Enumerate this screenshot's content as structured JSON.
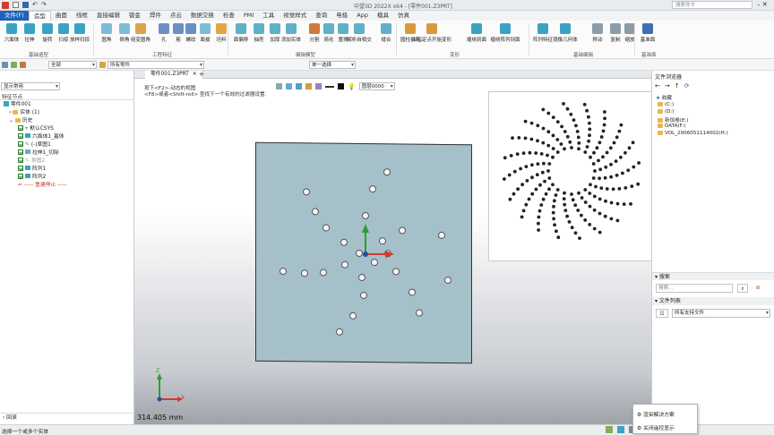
{
  "app": {
    "title": "中望3D 2022X x64 - [零件001.Z3PRT]",
    "search_placeholder": "搜索命令"
  },
  "menu": {
    "items": [
      "文件(F)",
      "造型",
      "曲面",
      "线框",
      "直接编辑",
      "钣金",
      "焊件",
      "点云",
      "数据交换",
      "检查",
      "PMI",
      "工具",
      "视觉样式",
      "查询",
      "电极",
      "App",
      "模具",
      "仿真"
    ],
    "active_index": 1
  },
  "ribbon": {
    "buttons": [
      "六面体",
      "拉伸",
      "旋转",
      "扫掠",
      "放样扫掠",
      "圆角",
      "倒角",
      "组变圆角",
      "孔",
      "筋",
      "螺纹",
      "面拔",
      "坯料",
      "面偏移",
      "抽壳",
      "加厚",
      "添加实体",
      "分割",
      "简化",
      "置换",
      "解析自相交",
      "缝合",
      "圆柱折弯",
      "由指定点开始变形",
      "缠绕到面",
      "缠绕阵列到面",
      "阵列特征",
      "镜像几何体",
      "移动",
      "复制",
      "缩放",
      "基准面"
    ],
    "groups": [
      "基础造型",
      "工程特征",
      "编辑模型",
      "变形",
      "基础编辑",
      "基准面"
    ]
  },
  "toolbar2": {
    "filter_all": "全部",
    "filter_parts": "所有零件",
    "select_mode": "单一选择",
    "layer": "图层0000"
  },
  "left_panel": {
    "display_combo": "显示常用",
    "tree_header": "特征节点",
    "tree": [
      "零件001",
      "实体 (1)",
      "历史",
      "默认CSYS",
      "六面体1_基体",
      "(-)草图1",
      "拉伸1_切除",
      "草图2",
      "阵列1",
      "阵列2",
      "----- 重建停止 -----"
    ],
    "bottom_section": "回滚"
  },
  "viewport": {
    "tab_label": "零件001.Z3PRT",
    "hint_line1": "按下<F2>-动态的视图",
    "hint_line2": "<F8>或者<Shift-roll> 查找下一个有效的过滤器设置.",
    "measure_value": "314.405 mm",
    "axis_x": "X",
    "axis_z": "Z"
  },
  "right_panel": {
    "title": "文件浏览器",
    "favorites": "收藏",
    "drives": [
      "(C:)",
      "(D:)",
      "新加卷(E:)",
      "DATA(F:)",
      "VOL_2006051114002(H:)"
    ],
    "search_title": "搜索",
    "search_placeholder": "搜索...",
    "file_list_title": "文件列表",
    "file_filter": "所有支持文件"
  },
  "status": {
    "text": "选择一个或多个实体"
  },
  "popup": {
    "items": [
      "渲染解决方案",
      "关闭遥控显示"
    ]
  },
  "colors": {
    "accent": "#1e63b8",
    "plate": "#a6c0c9",
    "check_green": "#2a7f2a"
  }
}
